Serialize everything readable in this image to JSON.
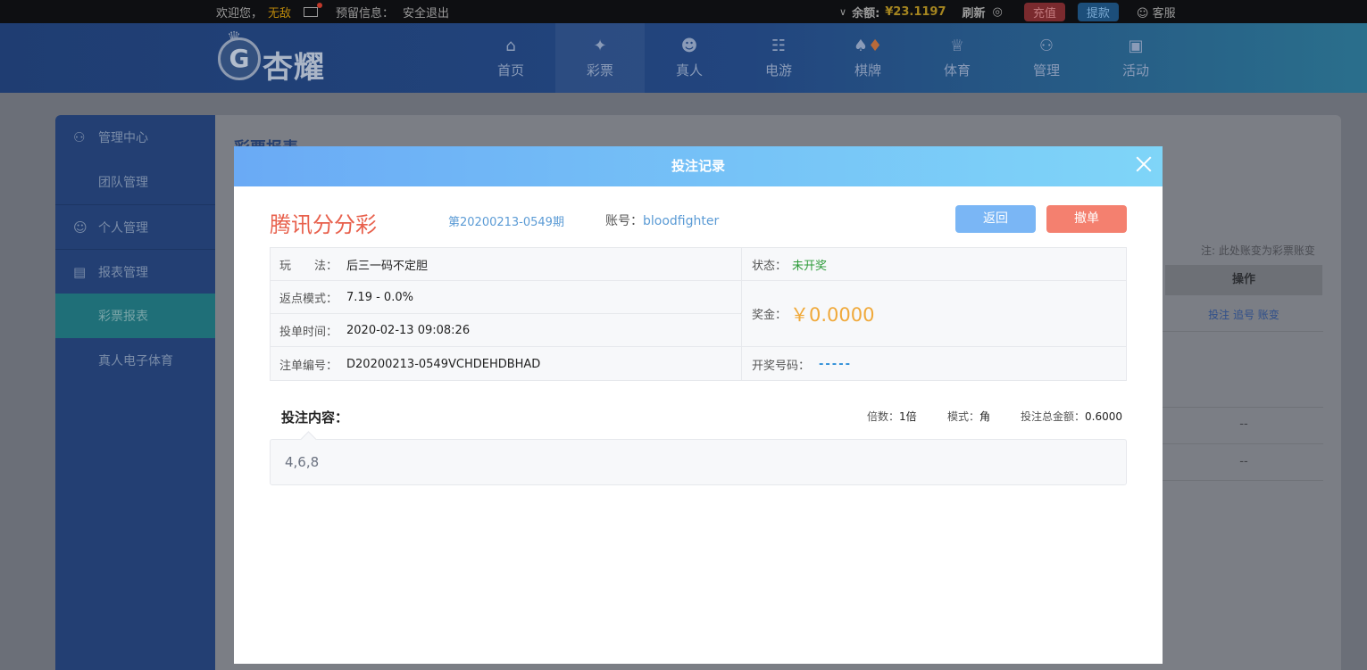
{
  "topbar": {
    "welcome": "欢迎您，",
    "username": "无敌",
    "reserved_info": "预留信息：",
    "logout": "安全退出",
    "balance_label": "余额:",
    "balance": "¥23.1197",
    "refresh": "刷新",
    "charge": "充值",
    "withdraw": "提款",
    "service": "客服"
  },
  "logo": {
    "text": "杏耀"
  },
  "nav": [
    {
      "label": "首页",
      "icon": "home-icon"
    },
    {
      "label": "彩票",
      "icon": "lottery-icon"
    },
    {
      "label": "真人",
      "icon": "live-dealer-icon"
    },
    {
      "label": "电游",
      "icon": "slot-icon"
    },
    {
      "label": "棋牌",
      "icon": "cards-icon"
    },
    {
      "label": "体育",
      "icon": "trophy-icon"
    },
    {
      "label": "管理",
      "icon": "users-icon"
    },
    {
      "label": "活动",
      "icon": "gift-icon"
    }
  ],
  "sidebar": [
    {
      "label": "管理中心",
      "group": true
    },
    {
      "label": "团队管理",
      "group": false
    },
    {
      "label": "个人管理",
      "group": true
    },
    {
      "label": "报表管理",
      "group": true
    },
    {
      "label": "彩票报表",
      "group": false
    },
    {
      "label": "真人电子体育",
      "group": false
    }
  ],
  "background": {
    "title": "彩票报表",
    "note": "注: 此处账变为彩票账变",
    "col_action": "操作",
    "row_links": "投注 追号 账变",
    "dash": "--"
  },
  "modal": {
    "title": "投注记录",
    "lottery_name": "腾讯分分彩",
    "period": "第20200213-0549期",
    "account_label": "账号：",
    "account": "bloodfighter",
    "back": "返回",
    "cancel": "撤单",
    "play_label": "玩　　法：",
    "play_value": "后三一码不定胆",
    "rebate_label": "返点模式：",
    "rebate_value": "7.19 - 0.0%",
    "time_label": "投单时间：",
    "time_value": "2020-02-13 09:08:26",
    "order_label": "注单编号：",
    "order_value": "D20200213-0549VCHDEHDBHAD",
    "status_label": "状态：",
    "status_value": "未开奖",
    "prize_label": "奖金：",
    "prize_value": "￥0.0000",
    "draw_label": "开奖号码：",
    "draw_value": "-----",
    "content_title": "投注内容：",
    "multiple_label": "倍数：",
    "multiple_value": "1倍",
    "mode_label": "模式：",
    "mode_value": "角",
    "total_label": "投注总金额：",
    "total_value": "0.6000",
    "content": "4,6,8"
  }
}
